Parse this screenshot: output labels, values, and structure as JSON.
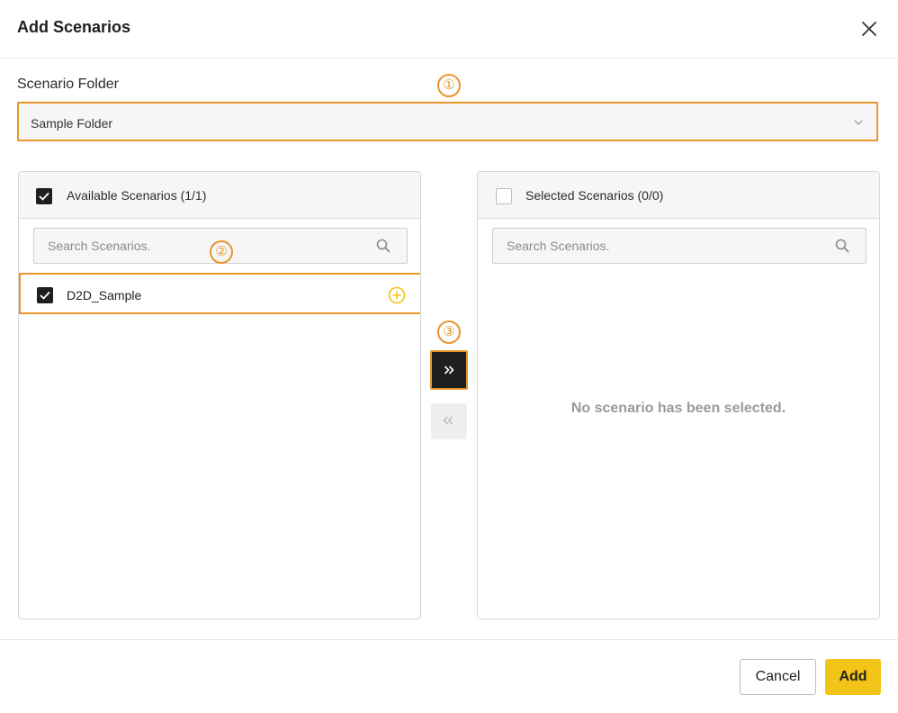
{
  "dialog": {
    "title": "Add Scenarios",
    "close_icon": "close-icon"
  },
  "folder": {
    "label": "Scenario Folder",
    "selected_value": "Sample Folder",
    "dropdown_icon": "chevron-down-icon"
  },
  "markers": {
    "one": "①",
    "two": "②",
    "three": "③"
  },
  "available": {
    "title": "Available Scenarios (1/1)",
    "header_checked": true,
    "search_placeholder": "Search Scenarios.",
    "items": [
      {
        "name": "D2D_Sample",
        "checked": true,
        "action_icon": "plus-circle-icon"
      }
    ]
  },
  "selected": {
    "title": "Selected Scenarios (0/0)",
    "header_checked": false,
    "search_placeholder": "Search Scenarios.",
    "empty_message": "No scenario has been selected."
  },
  "transfer": {
    "move_right_icon": "double-chevron-right-icon",
    "move_left_icon": "double-chevron-left-icon"
  },
  "footer": {
    "cancel_label": "Cancel",
    "add_label": "Add"
  },
  "colors": {
    "highlight": "#e8952b",
    "accent": "#f2c418",
    "dark": "#1f1f1f"
  }
}
